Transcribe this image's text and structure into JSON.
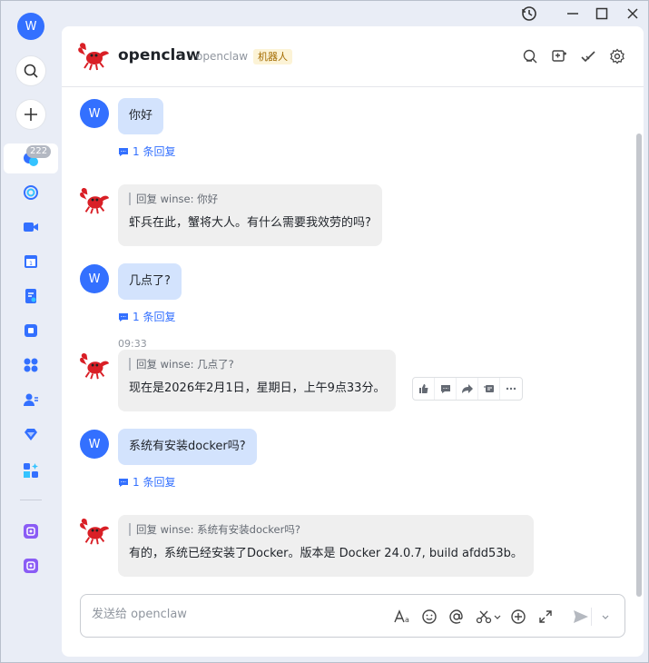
{
  "user": {
    "initial": "W"
  },
  "rail": {
    "chat_badge": "222"
  },
  "chat": {
    "title": "openclaw",
    "subtitle": "openclaw",
    "tag": "机器人"
  },
  "messages": [
    {
      "from": "user",
      "text": "你好",
      "reply_count": "1 条回复"
    },
    {
      "from": "bot",
      "quote": "回复 winse: 你好",
      "text": "虾兵在此，蟹将大人。有什么需要我效劳的吗?"
    },
    {
      "from": "user",
      "text": "几点了?",
      "reply_count": "1 条回复"
    },
    {
      "from": "bot",
      "time": "09:33",
      "quote": "回复 winse: 几点了?",
      "text": "现在是2026年2月1日，星期日，上午9点33分。"
    },
    {
      "from": "user",
      "text": "系统有安装docker吗?",
      "reply_count": "1 条回复"
    },
    {
      "from": "bot",
      "quote": "回复 winse: 系统有安装docker吗?",
      "text": "有的，系统已经安装了Docker。版本是 Docker 24.0.7, build afdd53b。"
    }
  ],
  "composer": {
    "placeholder": "发送给 openclaw"
  },
  "colors": {
    "accent": "#3370ff",
    "user_bubble": "#d3e3fd",
    "bot_bubble": "#efefef"
  },
  "icons": {
    "titlebar": [
      "history-icon",
      "minimize-icon",
      "maximize-icon",
      "close-icon"
    ],
    "header_actions": [
      "search-icon",
      "add-screen-icon",
      "checkmark-icon",
      "settings-icon"
    ],
    "msg_toolbar": [
      "thumbs-up-icon",
      "comment-icon",
      "forward-icon",
      "pin-icon",
      "more-icon"
    ],
    "composer": [
      "text-format-icon",
      "emoji-icon",
      "mention-icon",
      "scissors-icon",
      "plus-circle-icon",
      "expand-icon",
      "send-icon",
      "chevron-down-icon"
    ]
  }
}
